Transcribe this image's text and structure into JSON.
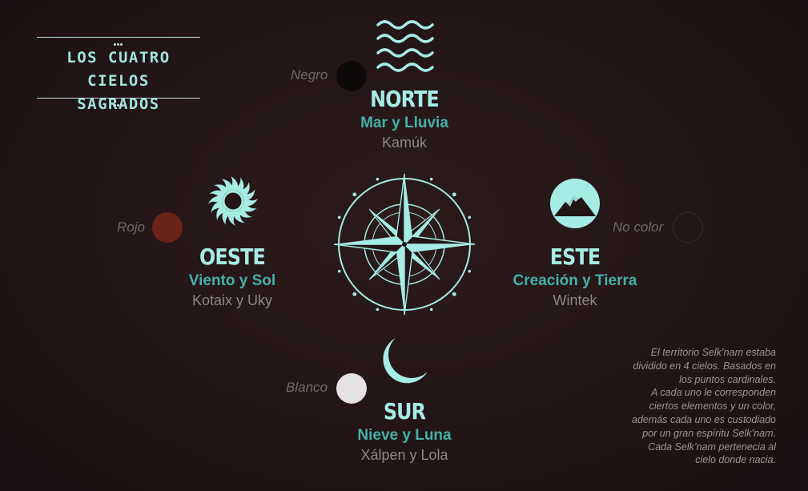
{
  "title": {
    "line1": "LOS CUATRO CIELOS",
    "line2": "SAGRADOS"
  },
  "accent_color": "#a5ece4",
  "element_color": "#43b1a9",
  "directions": {
    "north": {
      "name": "NORTE",
      "elements": "Mar y Lluvia",
      "spirit": "Kamúk",
      "color_label": "Negro",
      "color": "#0e0a0a",
      "icon": "waves-icon"
    },
    "west": {
      "name": "OESTE",
      "elements": "Viento y Sol",
      "spirit": "Kotaix y Uky",
      "color_label": "Rojo",
      "color": "#6b2218",
      "icon": "sun-icon"
    },
    "east": {
      "name": "ESTE",
      "elements": "Creación y Tierra",
      "spirit": "Wintek",
      "color_label": "No color",
      "color": "transparent",
      "icon": "mountain-icon"
    },
    "south": {
      "name": "SUR",
      "elements": "Nieve y Luna",
      "spirit": "Xálpen y Lola",
      "color_label": "Blanco",
      "color": "#e4e2e2",
      "icon": "moon-icon"
    }
  },
  "note_lines": [
    "El territorio Selk’nam estaba",
    "dividido en 4 cielos. Basados en",
    "los puntos cardinales.",
    "A cada uno le corresponden",
    "ciertos elementos y  un color,",
    "además cada uno es custodiado",
    "por un gran espíritu Selk’nam.",
    "Cada Selk’nam pertenecia al",
    "cielo donde nacia."
  ]
}
